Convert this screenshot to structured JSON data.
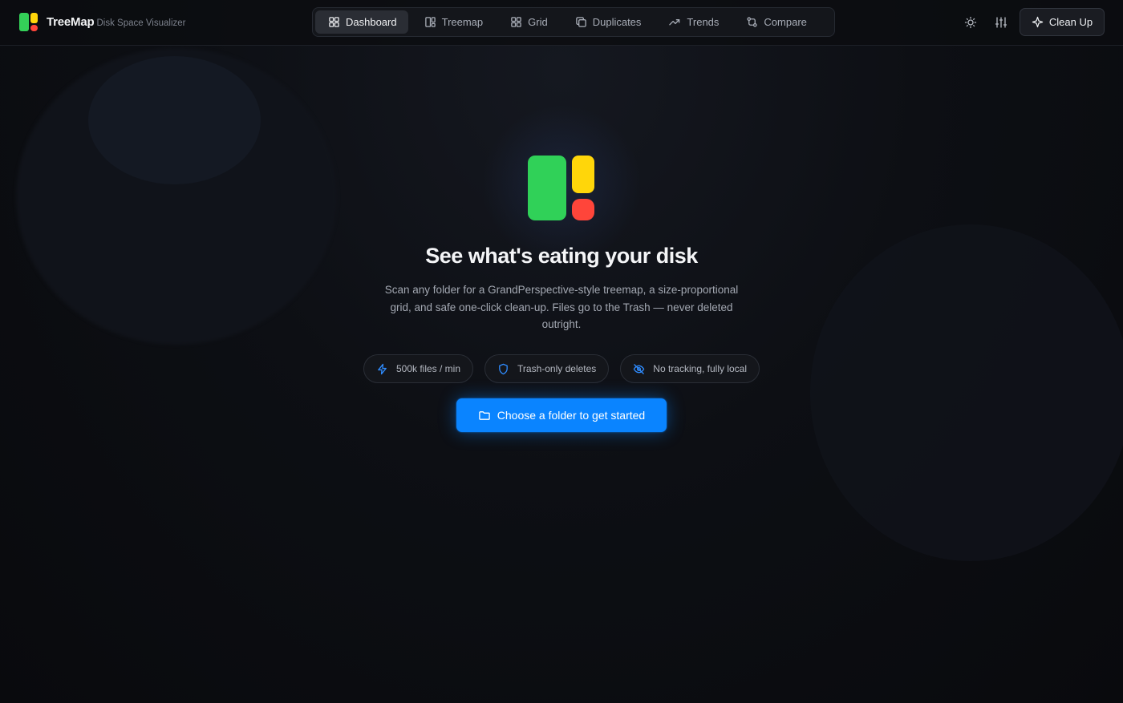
{
  "brand": {
    "name": "TreeMap",
    "subtitle": "Disk Space Visualizer"
  },
  "nav": {
    "tabs": [
      {
        "label": "Dashboard",
        "icon": "dashboard-icon",
        "active": true
      },
      {
        "label": "Treemap",
        "icon": "treemap-icon",
        "active": false
      },
      {
        "label": "Grid",
        "icon": "grid-icon",
        "active": false
      },
      {
        "label": "Duplicates",
        "icon": "duplicates-icon",
        "active": false
      },
      {
        "label": "Trends",
        "icon": "trends-icon",
        "active": false
      },
      {
        "label": "Compare",
        "icon": "compare-icon",
        "active": false
      }
    ]
  },
  "header": {
    "theme_icon": "sun-icon",
    "settings_icon": "sliders-icon",
    "cleanup_label": "Clean Up",
    "cleanup_icon": "sparkle-icon"
  },
  "hero": {
    "title": "See what's eating your disk",
    "description": "Scan any folder for a GrandPerspective-style treemap, a size-proportional grid, and safe one-click clean-up. Files go to the Trash — never deleted outright.",
    "pills": [
      {
        "label": "500k files / min",
        "icon": "lightning-icon"
      },
      {
        "label": "Trash-only deletes",
        "icon": "shield-icon"
      },
      {
        "label": "No tracking, fully local",
        "icon": "eye-off-icon"
      }
    ],
    "cta_label": "Choose a folder to get started",
    "cta_icon": "folder-icon"
  },
  "colors": {
    "accent": "#0a84ff",
    "logo_green": "#30d158",
    "logo_yellow": "#ffd60a",
    "logo_red": "#ff453a",
    "background": "#0b0c10"
  }
}
